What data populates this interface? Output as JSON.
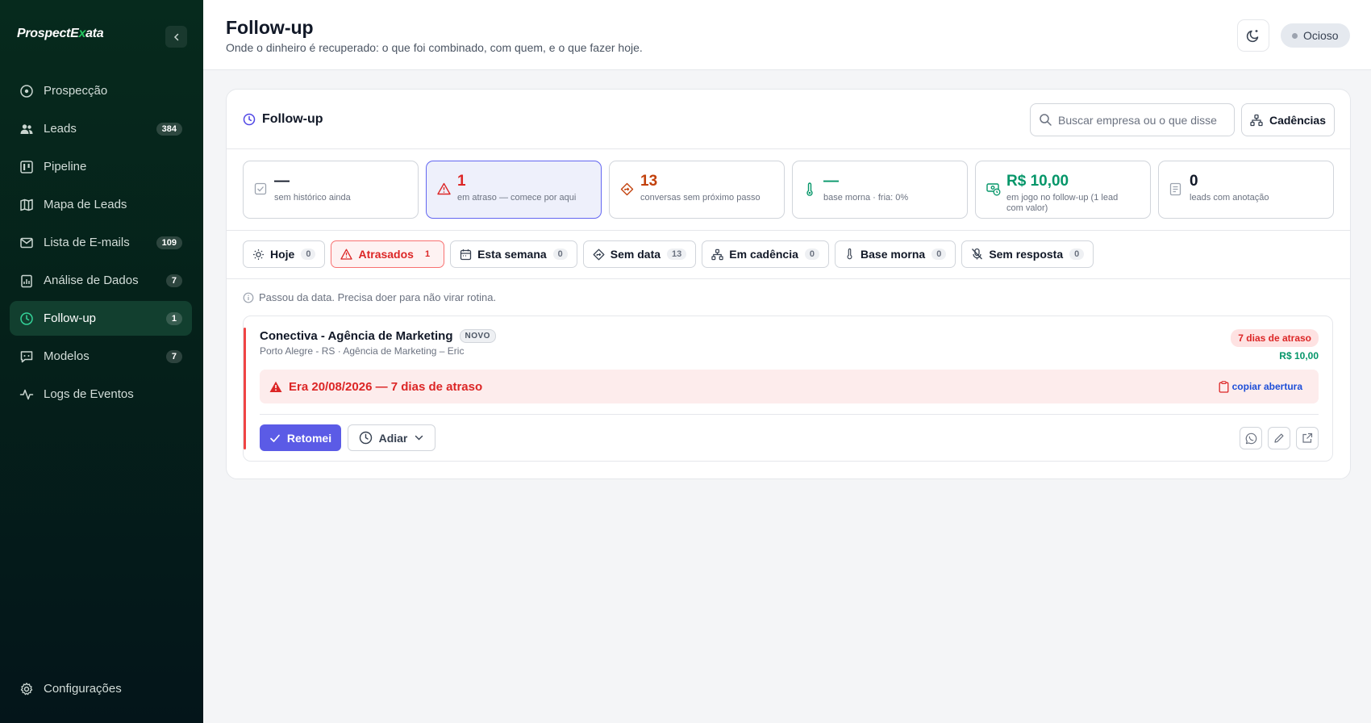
{
  "app": {
    "brand": "ProspectExata",
    "brand_parts": [
      "ProspectE",
      "x",
      "ata"
    ]
  },
  "sidebar": {
    "items": [
      {
        "label": "Prospecção",
        "icon": "target-icon"
      },
      {
        "label": "Leads",
        "icon": "users-icon",
        "badge": "384"
      },
      {
        "label": "Pipeline",
        "icon": "kanban-icon"
      },
      {
        "label": "Mapa de Leads",
        "icon": "map-icon"
      },
      {
        "label": "Lista de E-mails",
        "icon": "mail-icon",
        "badge": "109"
      },
      {
        "label": "Análise de Dados",
        "icon": "clipboard-chart-icon",
        "badge": "7"
      },
      {
        "label": "Follow-up",
        "icon": "clock-icon",
        "badge": "1",
        "active": true
      },
      {
        "label": "Modelos",
        "icon": "message-template-icon",
        "badge": "7"
      },
      {
        "label": "Logs de Eventos",
        "icon": "activity-icon"
      }
    ],
    "bottom": {
      "label": "Configurações",
      "icon": "gear-icon"
    }
  },
  "header": {
    "title": "Follow-up",
    "subtitle": "Onde o dinheiro é recuperado: o que foi combinado, com quem, e o que fazer hoje.",
    "status": "Ocioso"
  },
  "panel": {
    "title": "Follow-up",
    "search_placeholder": "Buscar empresa ou o que disse",
    "cadencias_label": "Cadências"
  },
  "stats": [
    {
      "value": "—",
      "label": "sem histórico ainda",
      "icon": "check-square-icon"
    },
    {
      "value": "1",
      "label": "em atraso — comece por aqui",
      "icon": "warning-icon"
    },
    {
      "value": "13",
      "label": "conversas sem próximo passo",
      "icon": "diamond-arrow-icon"
    },
    {
      "value": "—",
      "label": "base morna · fria: 0%",
      "icon": "thermometer-icon"
    },
    {
      "value": "R$ 10,00",
      "label": "em jogo no follow-up (1 lead com valor)",
      "icon": "money-clock-icon"
    },
    {
      "value": "0",
      "label": "leads com anotação",
      "icon": "notes-icon"
    }
  ],
  "tabs": [
    {
      "label": "Hoje",
      "count": "0",
      "icon": "sun-icon"
    },
    {
      "label": "Atrasados",
      "count": "1",
      "icon": "warning-icon",
      "active": true
    },
    {
      "label": "Esta semana",
      "count": "0",
      "icon": "calendar-icon"
    },
    {
      "label": "Sem data",
      "count": "13",
      "icon": "diamond-arrow-icon"
    },
    {
      "label": "Em cadência",
      "count": "0",
      "icon": "network-icon"
    },
    {
      "label": "Base morna",
      "count": "0",
      "icon": "thermometer-icon"
    },
    {
      "label": "Sem resposta",
      "count": "0",
      "icon": "mic-off-icon"
    }
  ],
  "hint": "Passou da data. Precisa doer para não virar rotina.",
  "lead": {
    "name": "Conectiva - Agência de Marketing",
    "tag": "NOVO",
    "meta": "Porto Alegre - RS · Agência de Marketing – Eric",
    "overdue": "7 dias de atraso",
    "value": "R$ 10,00",
    "alert": "Era 20/08/2026 — 7 dias de atraso",
    "copy_label": "copiar abertura",
    "primary_label": "Retomei",
    "secondary_label": "Adiar"
  },
  "colors": {
    "sidebar_bg": "#062a1d",
    "accent": "#5b5be6",
    "danger": "#dc2626",
    "success": "#059669",
    "warning": "#c2410c"
  }
}
